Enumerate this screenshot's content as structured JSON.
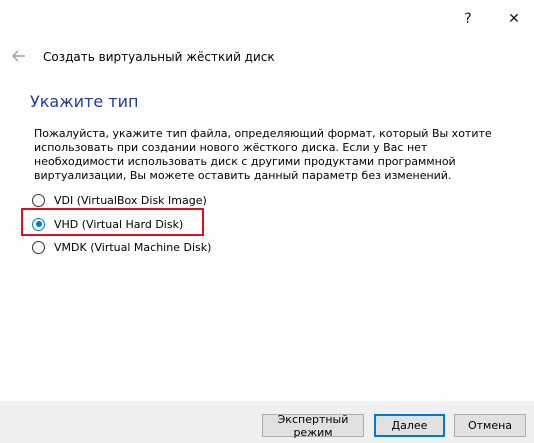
{
  "titlebar": {
    "help_label": "?",
    "close_label": "✕"
  },
  "header": {
    "back_icon": "arrow-left-icon",
    "title": "Создать виртуальный жёсткий диск"
  },
  "page": {
    "heading": "Укажите тип",
    "description": "Пожалуйста, укажите тип файла, определяющий формат, который Вы хотите использовать при создании нового жёсткого диска. Если у Вас нет необходимости использовать диск с другими продуктами программной виртуализации, Вы можете оставить данный параметр без изменений."
  },
  "disk_types": [
    {
      "label": "VDI (VirtualBox Disk Image)",
      "checked": false
    },
    {
      "label": "VHD (Virtual Hard Disk)",
      "checked": true
    },
    {
      "label": "VMDK (Virtual Machine Disk)",
      "checked": false
    }
  ],
  "highlight": {
    "color": "#e0101a"
  },
  "footer": {
    "expert_label": "Экспертный режим",
    "next_label": "Далее",
    "cancel_label": "Отмена"
  },
  "colors": {
    "heading": "#1f3d99",
    "accent": "#0078d7",
    "footer_bg": "#f0f0f0"
  }
}
